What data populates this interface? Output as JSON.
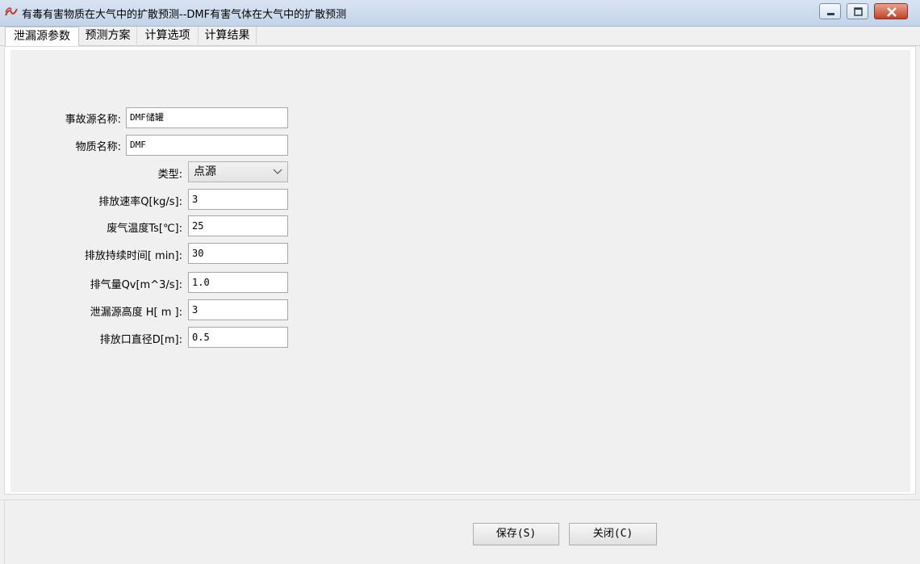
{
  "window": {
    "title": "有毒有害物质在大气中的扩散预测--DMF有害气体在大气中的扩散预测"
  },
  "tabs": [
    {
      "label": "泄漏源参数",
      "active": true
    },
    {
      "label": "预测方案",
      "active": false
    },
    {
      "label": "计算选项",
      "active": false
    },
    {
      "label": "计算结果",
      "active": false
    }
  ],
  "form": {
    "source_name": {
      "label": "事故源名称:",
      "value": "DMF储罐"
    },
    "substance_name": {
      "label": "物质名称:",
      "value": "DMF"
    },
    "type": {
      "label": "类型:",
      "value": "点源"
    },
    "release_rate": {
      "label": "排放速率Q[kg/s]:",
      "value": "3"
    },
    "gas_temp": {
      "label": "废气温度Ts[℃]:",
      "value": "25"
    },
    "duration": {
      "label": "排放持续时间[ min]:",
      "value": "30"
    },
    "gas_volume": {
      "label": "排气量Qv[m^3/s]:",
      "value": "1.0"
    },
    "source_height": {
      "label": "泄漏源高度 H[  m ]:",
      "value": "3"
    },
    "outlet_diameter": {
      "label": "排放口直径D[m]:",
      "value": "0.5"
    }
  },
  "buttons": {
    "save": "保存(S)",
    "close": "关闭(C)"
  },
  "colors": {
    "titlebar": "#c3d3e8",
    "close_button": "#c2412a",
    "panel_bg": "#f0f0f0"
  },
  "icons": [
    "app-icon",
    "minimize-icon",
    "maximize-icon",
    "close-icon",
    "chevron-down-icon"
  ]
}
